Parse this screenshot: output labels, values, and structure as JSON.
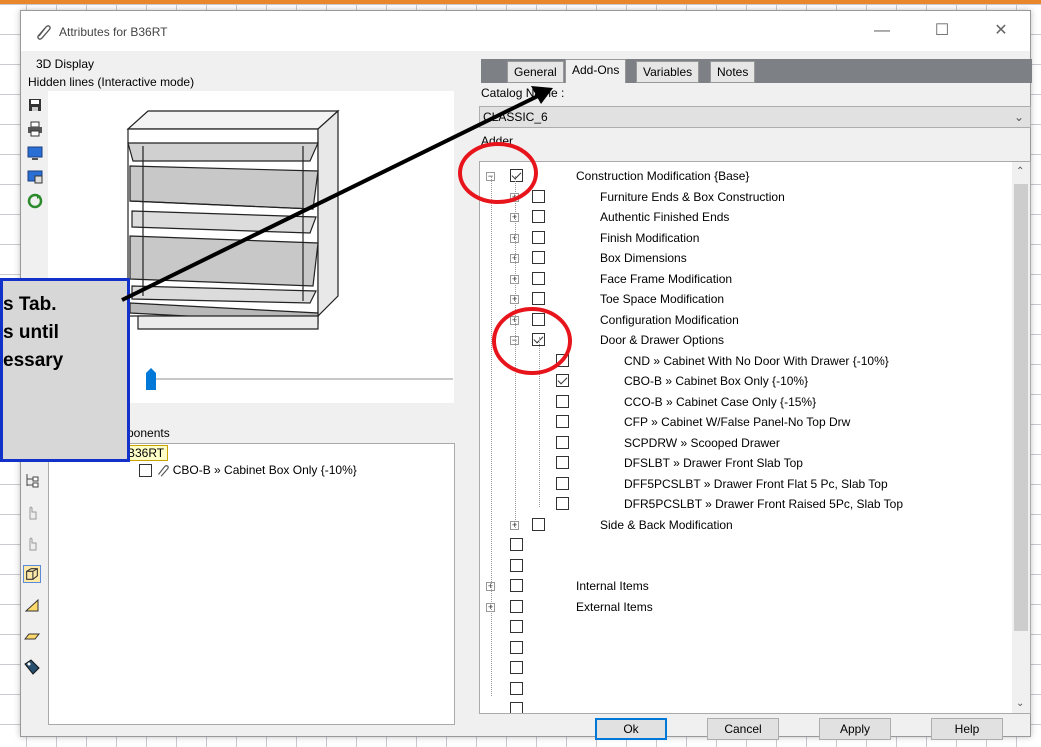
{
  "window": {
    "title": "Attributes for B36RT",
    "minimize": "—",
    "maximize": "☐",
    "close": "✕"
  },
  "left": {
    "display_group": "3D Display",
    "display_mode": "Hidden lines (Interactive mode)",
    "components_group": "ponents",
    "tree_root": "B36RT",
    "tree_child": "CBO-B » Cabinet Box Only  {-10%}"
  },
  "tabs": [
    {
      "label": "General",
      "active": false
    },
    {
      "label": "Add-Ons",
      "active": true
    },
    {
      "label": "Variables",
      "active": false
    },
    {
      "label": "Notes",
      "active": false
    }
  ],
  "catalog": {
    "label": "Catalog Name :",
    "value": "CLASSIC_6"
  },
  "adder_label": "Adder",
  "tree": {
    "root": {
      "label": "Construction Modification  {Base}",
      "checked": true
    },
    "level1_a": [
      {
        "label": "Furniture Ends & Box Construction",
        "checked": false
      },
      {
        "label": "Authentic Finished Ends",
        "checked": false
      },
      {
        "label": "Finish Modification",
        "checked": false
      },
      {
        "label": "Box Dimensions",
        "checked": false
      },
      {
        "label": "Face Frame Modification",
        "checked": false
      },
      {
        "label": "Toe Space Modification",
        "checked": false
      },
      {
        "label": "Configuration Modification",
        "checked": false
      },
      {
        "label": "Door & Drawer Options",
        "checked": true
      }
    ],
    "level2": [
      {
        "label": "CND » Cabinet With No Door With Drawer  {-10%}",
        "checked": false
      },
      {
        "label": "CBO-B » Cabinet Box Only  {-10%}",
        "checked": true
      },
      {
        "label": "CCO-B » Cabinet Case Only  {-15%}",
        "checked": false
      },
      {
        "label": "CFP » Cabinet W/False Panel-No Top Drw",
        "checked": false
      },
      {
        "label": "SCPDRW » Scooped Drawer",
        "checked": false
      },
      {
        "label": "DFSLBT » Drawer Front Slab Top",
        "checked": false
      },
      {
        "label": "DFF5PCSLBT » Drawer Front Flat 5 Pc, Slab Top",
        "checked": false
      },
      {
        "label": "DFR5PCSLBT » Drawer Front Raised 5Pc, Slab Top",
        "checked": false
      }
    ],
    "level1_b": [
      {
        "label": "Side & Back Modification",
        "checked": false
      }
    ],
    "top_items": [
      {
        "label": "",
        "expand": false
      },
      {
        "label": "",
        "expand": false
      },
      {
        "label": "Internal Items",
        "expand": true
      },
      {
        "label": "External Items",
        "expand": true
      },
      {
        "label": "",
        "expand": false
      },
      {
        "label": "",
        "expand": false
      },
      {
        "label": "",
        "expand": false
      },
      {
        "label": "",
        "expand": false
      },
      {
        "label": "",
        "expand": false
      }
    ]
  },
  "buttons": {
    "ok": "Ok",
    "cancel": "Cancel",
    "apply": "Apply",
    "help": "Help"
  },
  "callout": {
    "line1": "s Tab.",
    "line2": "s until",
    "line3": "essary"
  },
  "colors": {
    "highlight_circle": "#e8141b",
    "callout_border": "#1231c8",
    "accent": "#0078d7"
  }
}
